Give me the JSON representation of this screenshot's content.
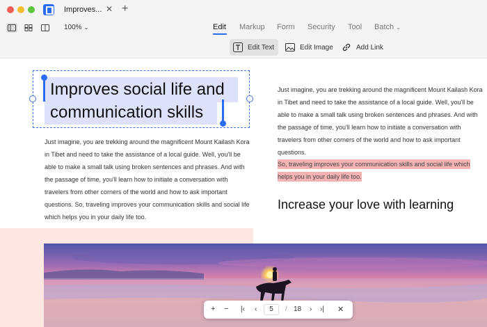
{
  "window": {
    "tab_title": "Improves...",
    "tab_close": "✕",
    "new_tab": "+"
  },
  "toolbar": {
    "zoom": "100%",
    "menus": [
      "Edit",
      "Markup",
      "Form",
      "Security",
      "Tool",
      "Batch"
    ],
    "active_menu": "Edit"
  },
  "edit_tools": {
    "edit_text": "Edit Text",
    "edit_image": "Edit Image",
    "add_link": "Add Link",
    "active": "Edit Text"
  },
  "document": {
    "heading": "Improves social life and communication skills",
    "heading_line1": "Improves social life and",
    "heading_line2": "communication skills",
    "paragraph_left": "Just imagine, you are trekking around the magnificent Mount Kailash Kora in Tibet and need to take the assistance of a local guide. Well, you'll be able to make a small talk using broken sentences and phrases. And with the passage of time, you'll learn how to initiate a conversation with travelers from other corners of the world and how to ask important questions. So, traveling improves your communication skills and social life which helps you in your daily life too.",
    "paragraph_right": "Just imagine, you are trekking around the magnificent Mount Kailash Kora in Tibet and need to take the assistance of a local guide. Well, you'll be able to make a small talk using broken sentences and phrases. And with the passage of time, you'll learn how to initiate a conversation with travelers from other corners of the world and how to ask important questions.",
    "highlighted": "So, traveling improves your communication skills and social life which helps you in your daily life too.",
    "section_heading": "Increase your love with learning"
  },
  "pager": {
    "zoom_in": "+",
    "zoom_out": "−",
    "first": "|‹",
    "prev": "‹",
    "current_page": "5",
    "separator": "/",
    "total_pages": "18",
    "next": "›",
    "last": "›|",
    "close": "✕"
  },
  "colors": {
    "accent": "#2b6cf5",
    "highlight": "#f6b3b3",
    "selection": "#dde2fa"
  }
}
